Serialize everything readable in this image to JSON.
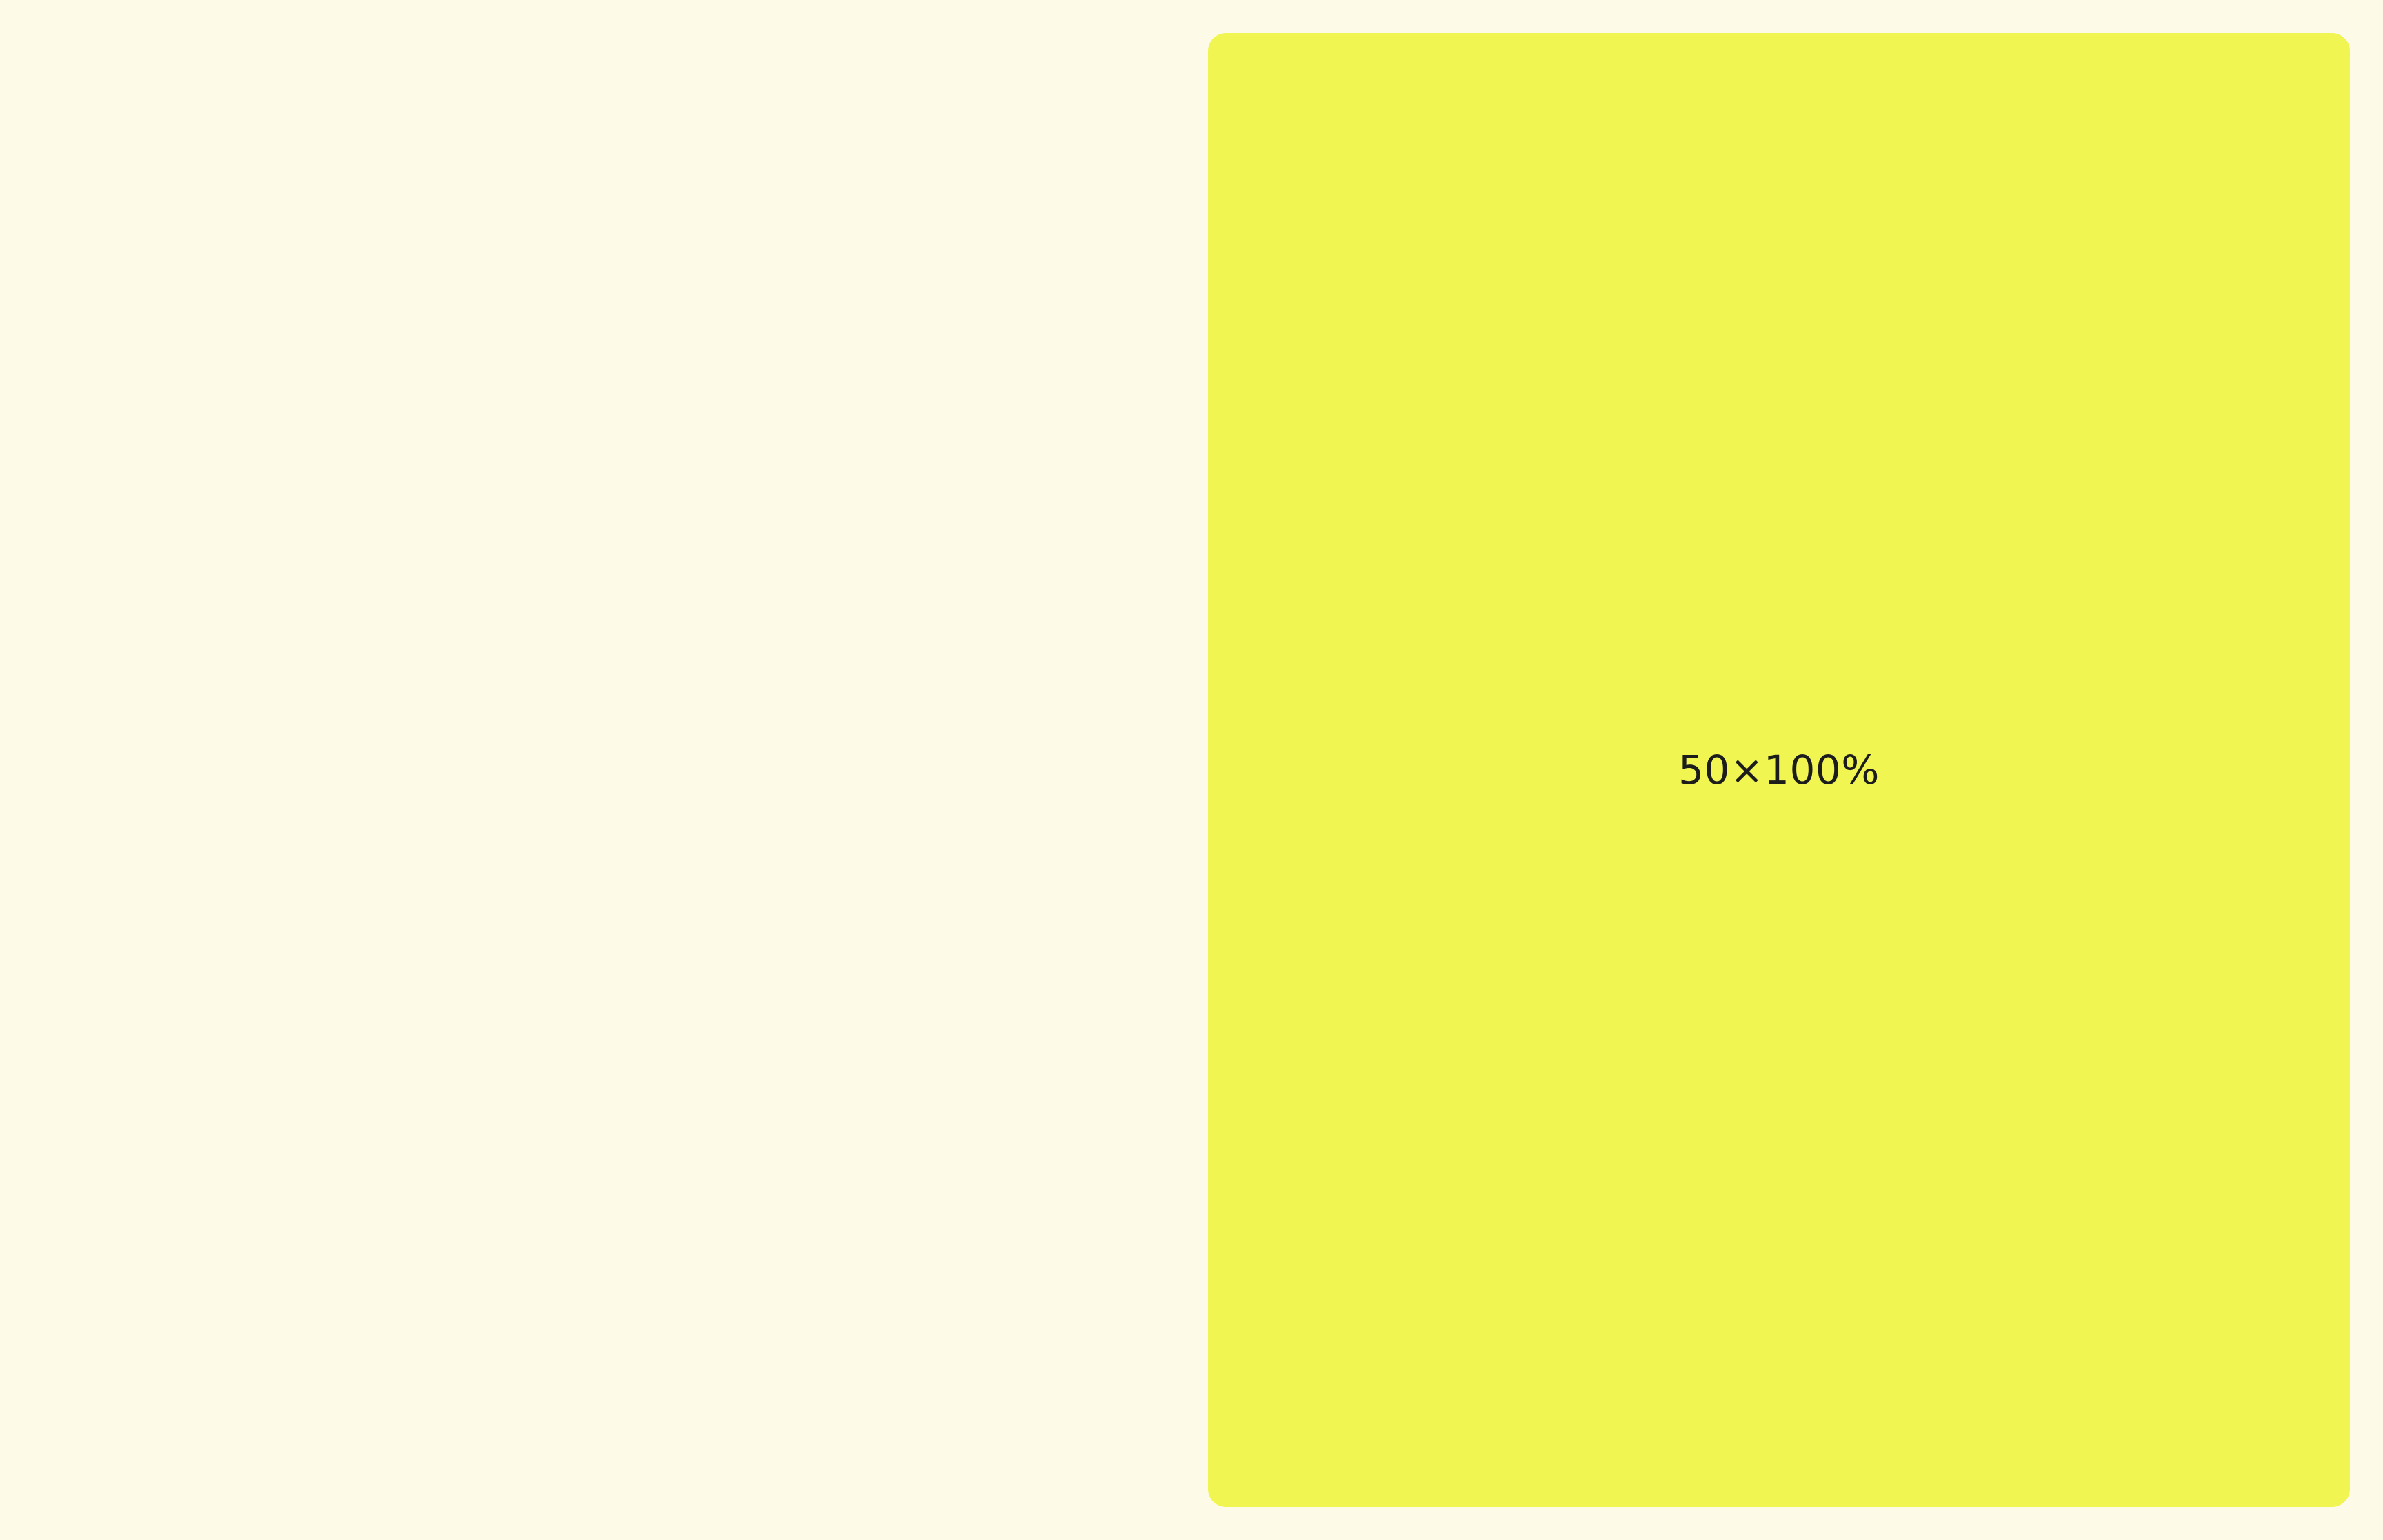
{
  "canvas": {
    "background_color": "#fefae8"
  },
  "panel": {
    "label": "50×100%",
    "color": "#f0f552",
    "text_color": "#1c1c1c"
  }
}
